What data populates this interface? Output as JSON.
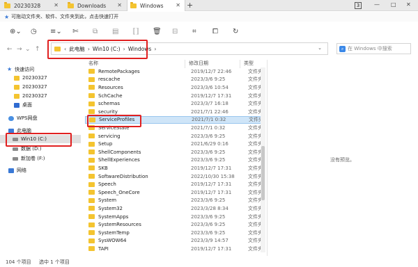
{
  "tabs": [
    {
      "label": "20230328"
    },
    {
      "label": "Downloads"
    },
    {
      "label": "Windows"
    }
  ],
  "tab_plus": "+",
  "tab_count": "3",
  "window_controls": {
    "minimize": "—",
    "maximize": "□",
    "close": "✕"
  },
  "bookmark_text": "可拖动文件夹、软件、文件夹到此，点击快速打开",
  "toolbar_icons": [
    "new-icon",
    "history-icon",
    "view-icon",
    "cut-icon",
    "copy-icon",
    "paste-icon",
    "rename-icon",
    "delete-icon",
    "crop-icon",
    "share-icon",
    "refresh-icon"
  ],
  "nav": {
    "back": "←",
    "forward": "→",
    "up": "↑",
    "dropdown": "⌄"
  },
  "address": {
    "crumbs": [
      "此电脑",
      "Win10 (C:)",
      "Windows"
    ],
    "sep": "›",
    "lead_sep": "‹"
  },
  "search": {
    "placeholder": "在 Windows 中搜索"
  },
  "sidebar": {
    "quick_access": "快速访问",
    "quick_items": [
      "20230327",
      "20230327",
      "20230327"
    ],
    "desktop": "桌面",
    "wps": "WPS网盘",
    "this_pc": "此电脑",
    "drives": [
      "Win10 (C:)",
      "数据 (D:)",
      "新加卷 (F:)"
    ],
    "network": "网络"
  },
  "columns": {
    "name": "名称",
    "date": "修改日期",
    "type": "类型"
  },
  "files": [
    {
      "name": "RemotePackages",
      "date": "2019/12/7 22:46",
      "type": "文件夹"
    },
    {
      "name": "rescache",
      "date": "2023/3/6 9:25",
      "type": "文件夹"
    },
    {
      "name": "Resources",
      "date": "2023/3/6 10:54",
      "type": "文件夹"
    },
    {
      "name": "SchCache",
      "date": "2019/12/7 17:31",
      "type": "文件夹"
    },
    {
      "name": "schemas",
      "date": "2023/3/7 16:18",
      "type": "文件夹"
    },
    {
      "name": "security",
      "date": "2021/7/1 22:46",
      "type": "文件夹"
    },
    {
      "name": "ServiceProfiles",
      "date": "2021/7/1 0:32",
      "type": "文件夹"
    },
    {
      "name": "ServiceState",
      "date": "2021/7/1 0:32",
      "type": "文件夹"
    },
    {
      "name": "servicing",
      "date": "2023/3/6 9:25",
      "type": "文件夹"
    },
    {
      "name": "Setup",
      "date": "2021/6/29 0:16",
      "type": "文件夹"
    },
    {
      "name": "ShellComponents",
      "date": "2023/3/6 9:25",
      "type": "文件夹"
    },
    {
      "name": "ShellExperiences",
      "date": "2023/3/6 9:25",
      "type": "文件夹"
    },
    {
      "name": "SKB",
      "date": "2019/12/7 17:31",
      "type": "文件夹"
    },
    {
      "name": "SoftwareDistribution",
      "date": "2022/10/30 15:38",
      "type": "文件夹"
    },
    {
      "name": "Speech",
      "date": "2019/12/7 17:31",
      "type": "文件夹"
    },
    {
      "name": "Speech_OneCore",
      "date": "2019/12/7 17:31",
      "type": "文件夹"
    },
    {
      "name": "System",
      "date": "2023/3/6 9:25",
      "type": "文件夹"
    },
    {
      "name": "System32",
      "date": "2023/3/28 8:34",
      "type": "文件夹"
    },
    {
      "name": "SystemApps",
      "date": "2023/3/6 9:25",
      "type": "文件夹"
    },
    {
      "name": "SystemResources",
      "date": "2023/3/6 9:25",
      "type": "文件夹"
    },
    {
      "name": "SystemTemp",
      "date": "2023/3/6 9:25",
      "type": "文件夹"
    },
    {
      "name": "SysWOW64",
      "date": "2023/3/9 14:57",
      "type": "文件夹"
    },
    {
      "name": "TAPI",
      "date": "2019/12/7 17:31",
      "type": "文件夹"
    }
  ],
  "selected_file": "ServiceProfiles",
  "preview_text": "没有预览。",
  "status": {
    "count": "104 个项目",
    "selected": "选中 1 个项目"
  },
  "colors": {
    "highlight": "#e02020",
    "selection": "#cfe5f8",
    "folder": "#f4c430"
  }
}
